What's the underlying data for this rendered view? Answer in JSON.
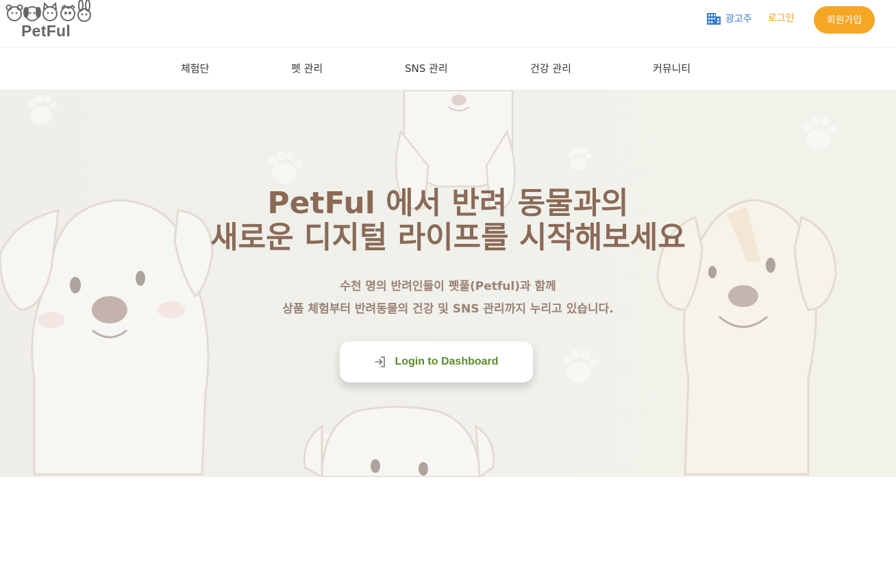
{
  "header": {
    "logo_text": "PetFul",
    "advertiser_label": "광고주",
    "login_label": "로그인",
    "signup_label": "회원가입"
  },
  "nav": {
    "items": [
      {
        "label": "체험단"
      },
      {
        "label": "펫 관리"
      },
      {
        "label": "SNS 관리"
      },
      {
        "label": "건강 관리"
      },
      {
        "label": "커뮤니티"
      }
    ]
  },
  "hero": {
    "title_line1": "PetFul 에서 반려 동물과의",
    "title_line2": "새로운 디지털 라이프를 시작해보세요",
    "subtitle_line1": "수천 명의 반려인들이 펫풀(Petful)과 함께",
    "subtitle_line2": "상품 체험부터 반려동물의 건강 및 SNS 관리까지 누리고 있습니다.",
    "cta_label": "Login to Dashboard"
  },
  "colors": {
    "brand_orange": "#f5a623",
    "advertiser_blue": "#3a7bd5",
    "title_brown": "#8a6a57",
    "cta_green": "#5d8a2a"
  },
  "icons": {
    "advertiser": "building-icon",
    "cta": "login-arrow-icon",
    "logo": "pet-faces-logo"
  }
}
